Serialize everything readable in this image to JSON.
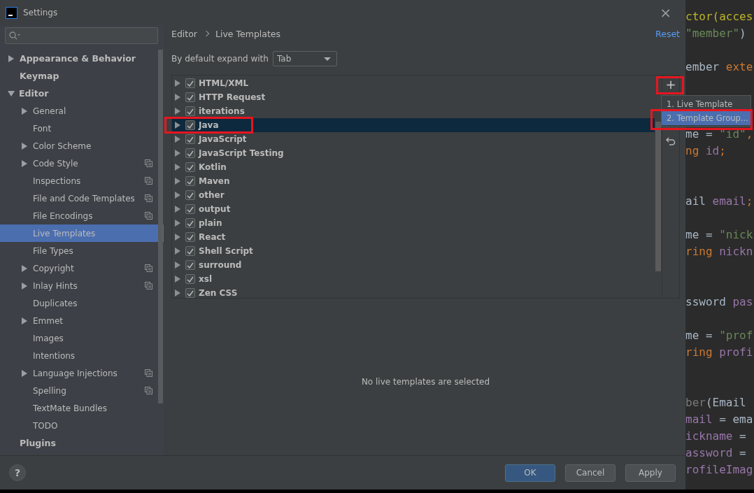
{
  "window": {
    "title": "Settings",
    "close": "×"
  },
  "sidebar": {
    "items": [
      {
        "label": "Appearance & Behavior",
        "expanded": false,
        "selected": false
      },
      {
        "label": "Keymap",
        "selected": false
      },
      {
        "label": "Editor",
        "expanded": true,
        "selected": false,
        "children": [
          {
            "label": "General",
            "expanded": false,
            "project": false,
            "selected": false
          },
          {
            "label": "Font",
            "project": false,
            "selected": false
          },
          {
            "label": "Color Scheme",
            "expanded": false,
            "project": false,
            "selected": false
          },
          {
            "label": "Code Style",
            "expanded": false,
            "project": true,
            "selected": false
          },
          {
            "label": "Inspections",
            "project": true,
            "selected": false
          },
          {
            "label": "File and Code Templates",
            "project": true,
            "selected": false
          },
          {
            "label": "File Encodings",
            "project": true,
            "selected": false
          },
          {
            "label": "Live Templates",
            "project": false,
            "selected": true
          },
          {
            "label": "File Types",
            "project": false,
            "selected": false
          },
          {
            "label": "Copyright",
            "expanded": false,
            "project": true,
            "selected": false
          },
          {
            "label": "Inlay Hints",
            "expanded": false,
            "project": true,
            "selected": false
          },
          {
            "label": "Duplicates",
            "project": false,
            "selected": false
          },
          {
            "label": "Emmet",
            "expanded": false,
            "project": false,
            "selected": false
          },
          {
            "label": "Images",
            "project": false,
            "selected": false
          },
          {
            "label": "Intentions",
            "project": false,
            "selected": false
          },
          {
            "label": "Language Injections",
            "expanded": false,
            "project": true,
            "selected": false
          },
          {
            "label": "Spelling",
            "project": true,
            "selected": false
          },
          {
            "label": "TextMate Bundles",
            "project": false,
            "selected": false
          },
          {
            "label": "TODO",
            "project": false,
            "selected": false
          }
        ]
      },
      {
        "label": "Plugins",
        "selected": false
      }
    ]
  },
  "breadcrumb": [
    "Editor",
    "Live Templates"
  ],
  "reset": "Reset",
  "expand_with": {
    "label": "By default expand with",
    "value": "Tab"
  },
  "templates": [
    {
      "label": "HTML/XML",
      "checked": true,
      "selected": false,
      "highlighted": false
    },
    {
      "label": "HTTP Request",
      "checked": true,
      "selected": false,
      "highlighted": false
    },
    {
      "label": "iterations",
      "checked": true,
      "selected": false,
      "highlighted": false
    },
    {
      "label": "Java",
      "checked": true,
      "selected": true,
      "highlighted": true
    },
    {
      "label": "JavaScript",
      "checked": true,
      "selected": false,
      "highlighted": false
    },
    {
      "label": "JavaScript Testing",
      "checked": true,
      "selected": false,
      "highlighted": false
    },
    {
      "label": "Kotlin",
      "checked": true,
      "selected": false,
      "highlighted": false
    },
    {
      "label": "Maven",
      "checked": true,
      "selected": false,
      "highlighted": false
    },
    {
      "label": "other",
      "checked": true,
      "selected": false,
      "highlighted": false
    },
    {
      "label": "output",
      "checked": true,
      "selected": false,
      "highlighted": false
    },
    {
      "label": "plain",
      "checked": true,
      "selected": false,
      "highlighted": false
    },
    {
      "label": "React",
      "checked": true,
      "selected": false,
      "highlighted": false
    },
    {
      "label": "Shell Script",
      "checked": true,
      "selected": false,
      "highlighted": false
    },
    {
      "label": "surround",
      "checked": true,
      "selected": false,
      "highlighted": false
    },
    {
      "label": "xsl",
      "checked": true,
      "selected": false,
      "highlighted": false
    },
    {
      "label": "Zen CSS",
      "checked": true,
      "selected": false,
      "highlighted": false
    }
  ],
  "add_button": {
    "label": "+",
    "highlighted": true
  },
  "add_menu": [
    {
      "label": "1. Live Template",
      "selected": false,
      "highlighted": false
    },
    {
      "label": "2. Template Group...",
      "selected": true,
      "highlighted": true
    }
  ],
  "empty_message": "No live templates are selected",
  "buttons": [
    {
      "label": "OK",
      "kind": "primary"
    },
    {
      "label": "Cancel",
      "kind": "normal"
    },
    {
      "label": "Apply",
      "kind": "normal"
    }
  ],
  "help": "?",
  "code_lines": [
    {
      "kind": "code",
      "tokens": [
        {
          "t": "ctor(acces",
          "kind": "annotation"
        }
      ]
    },
    {
      "kind": "code",
      "tokens": [
        {
          "t": "\"member\"",
          "kind": "string"
        },
        {
          "t": ")",
          "kind": "plain"
        }
      ]
    },
    {
      "kind": "blank"
    },
    {
      "kind": "code",
      "tokens": [
        {
          "t": "ember ",
          "kind": "plain"
        },
        {
          "t": "exte",
          "kind": "keyword"
        }
      ]
    },
    {
      "kind": "blank"
    },
    {
      "kind": "blank"
    },
    {
      "kind": "blank"
    },
    {
      "kind": "code",
      "tokens": [
        {
          "t": "me = ",
          "kind": "plain"
        },
        {
          "t": "\"id\"",
          "kind": "string"
        },
        {
          "t": ",",
          "kind": "keyword"
        }
      ]
    },
    {
      "kind": "code",
      "tokens": [
        {
          "t": "ng ",
          "kind": "keyword"
        },
        {
          "t": "id",
          "kind": "field"
        },
        {
          "t": ";",
          "kind": "keyword"
        }
      ]
    },
    {
      "kind": "blank"
    },
    {
      "kind": "blank"
    },
    {
      "kind": "code",
      "tokens": [
        {
          "t": "ail ",
          "kind": "plain"
        },
        {
          "t": "email",
          "kind": "field"
        },
        {
          "t": ";",
          "kind": "keyword"
        }
      ]
    },
    {
      "kind": "blank"
    },
    {
      "kind": "code",
      "tokens": [
        {
          "t": "me = ",
          "kind": "plain"
        },
        {
          "t": "\"nick",
          "kind": "string"
        }
      ]
    },
    {
      "kind": "code",
      "tokens": [
        {
          "t": "ring ",
          "kind": "keyword"
        },
        {
          "t": "nickn",
          "kind": "field"
        }
      ]
    },
    {
      "kind": "blank"
    },
    {
      "kind": "blank"
    },
    {
      "kind": "code",
      "tokens": [
        {
          "t": "ssword ",
          "kind": "plain"
        },
        {
          "t": "pas",
          "kind": "field"
        }
      ]
    },
    {
      "kind": "blank"
    },
    {
      "kind": "code",
      "tokens": [
        {
          "t": "me = ",
          "kind": "plain"
        },
        {
          "t": "\"prof",
          "kind": "string"
        }
      ]
    },
    {
      "kind": "code",
      "tokens": [
        {
          "t": "ring ",
          "kind": "keyword"
        },
        {
          "t": "profi",
          "kind": "field"
        }
      ]
    },
    {
      "kind": "blank"
    },
    {
      "kind": "blank"
    },
    {
      "kind": "code",
      "tokens": [
        {
          "t": "ber",
          "kind": "dim"
        },
        {
          "t": "(Email",
          "kind": "plain"
        }
      ]
    },
    {
      "kind": "code",
      "tokens": [
        {
          "t": "mail",
          "kind": "field"
        },
        {
          "t": " = ema",
          "kind": "plain"
        }
      ]
    },
    {
      "kind": "code",
      "tokens": [
        {
          "t": "ickname",
          "kind": "field"
        },
        {
          "t": " =",
          "kind": "plain"
        }
      ]
    },
    {
      "kind": "code",
      "tokens": [
        {
          "t": "assword",
          "kind": "field"
        },
        {
          "t": " =",
          "kind": "plain"
        }
      ]
    },
    {
      "kind": "code",
      "tokens": [
        {
          "t": "rofileImag",
          "kind": "field"
        }
      ]
    }
  ]
}
